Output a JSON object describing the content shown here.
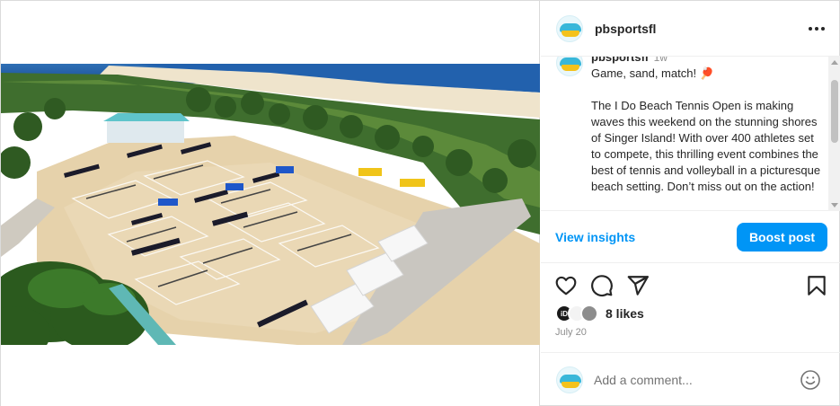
{
  "post": {
    "username": "pbsportsfl",
    "time_ago": "1w",
    "caption_title": "Game, sand, match! 🏓",
    "caption_body": "The I Do Beach Tennis Open is making waves this weekend on the stunning shores of Singer Island! With over 400 athletes set to compete, this thrilling event combines the best of tennis and volleyball in a picturesque beach setting. Don’t miss out on the action!",
    "view_insights_label": "View insights",
    "boost_label": "Boost post",
    "likes_label": "8 likes",
    "date": "July 20",
    "comment_placeholder": "Add a comment...",
    "liker_badge": "iD"
  },
  "icons": [
    "more-icon",
    "heart-icon",
    "comment-icon",
    "share-icon",
    "bookmark-icon",
    "emoji-icon"
  ],
  "colors": {
    "accent": "#0095f6",
    "text": "#262626",
    "muted": "#8e8e8e",
    "border": "#dbdbdb",
    "sand": "#e8d4b0",
    "ocean": "#1f5fa8"
  }
}
